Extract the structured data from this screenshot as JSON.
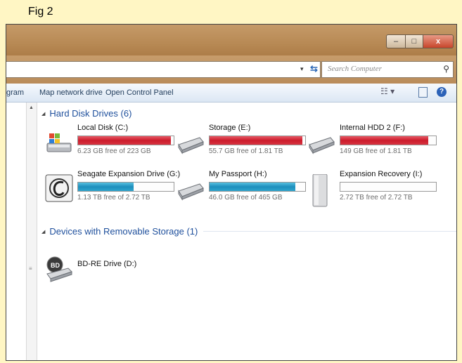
{
  "figure_label": "Fig 2",
  "window": {
    "buttons": {
      "minimize": "–",
      "maximize": "□",
      "close": "x"
    }
  },
  "address_bar": {
    "dropdown_icon": "chevron-down-icon",
    "refresh_icon": "refresh-icon",
    "search_placeholder": "Search Computer",
    "search_icon": "search-icon"
  },
  "toolbar": {
    "items": [
      "gram",
      "Map network drive",
      "Open Control Panel"
    ],
    "views_icon": "views-icon",
    "preview_pane_icon": "preview-pane-icon",
    "help_icon": "help-icon",
    "help_glyph": "?"
  },
  "groups": {
    "hard_disks": {
      "title": "Hard Disk Drives (6)"
    },
    "removable": {
      "title": "Devices with Removable Storage (1)"
    }
  },
  "drives": [
    {
      "name": "Local Disk (C:)",
      "free": "6.23 GB free of 223 GB",
      "used_fraction": 0.97,
      "bar_color": "red",
      "icon": "windows-drive-icon"
    },
    {
      "name": "Storage (E:)",
      "free": "55.7 GB free of 1.81 TB",
      "used_fraction": 0.97,
      "bar_color": "red",
      "icon": "hard-drive-icon"
    },
    {
      "name": "Internal HDD 2 (F:)",
      "free": "149 GB free of 1.81 TB",
      "used_fraction": 0.92,
      "bar_color": "red",
      "icon": "hard-drive-icon"
    },
    {
      "name": "Seagate Expansion Drive (G:)",
      "free": "1.13 TB free of 2.72 TB",
      "used_fraction": 0.58,
      "bar_color": "blue",
      "icon": "seagate-drive-icon"
    },
    {
      "name": "My Passport (H:)",
      "free": "46.0 GB free of 465 GB",
      "used_fraction": 0.9,
      "bar_color": "blue",
      "icon": "hard-drive-icon"
    },
    {
      "name": "Expansion Recovery (I:)",
      "free": "2.72 TB free of 2.72 TB",
      "used_fraction": 0.0,
      "bar_color": "blue",
      "icon": "external-drive-icon"
    }
  ],
  "removable_drives": [
    {
      "name": "BD-RE Drive (D:)",
      "icon": "bd-drive-icon",
      "icon_text": "BD"
    }
  ],
  "colors": {
    "title_bar": "#b88a55",
    "usage_red": "#cc1c2c",
    "usage_blue": "#1e8fbd",
    "group_header": "#1e4f9c"
  }
}
